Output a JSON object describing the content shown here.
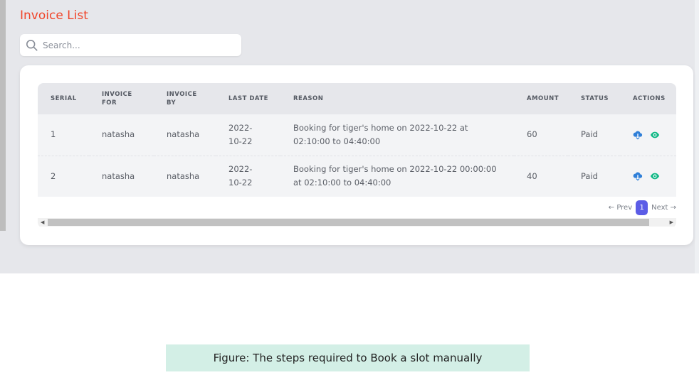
{
  "page": {
    "title": "Invoice List"
  },
  "search": {
    "placeholder": "Search..."
  },
  "table": {
    "columns": [
      "SERIAL",
      "INVOICE FOR",
      "INVOICE BY",
      "LAST DATE",
      "REASON",
      "AMOUNT",
      "STATUS",
      "ACTIONS"
    ],
    "rows": [
      {
        "serial": "1",
        "invoice_for": "natasha",
        "invoice_by": "natasha",
        "last_date": "2022-10-22",
        "reason": "Booking for tiger's home on 2022-10-22 at 02:10:00 to 04:40:00",
        "amount": "60",
        "status": "Paid"
      },
      {
        "serial": "2",
        "invoice_for": "natasha",
        "invoice_by": "natasha",
        "last_date": "2022-10-22",
        "reason": "Booking for tiger's home on 2022-10-22 00:00:00 at 02:10:00 to 04:40:00",
        "amount": "40",
        "status": "Paid"
      }
    ],
    "actions": [
      {
        "icon": "download-cloud-icon",
        "color": "#2f7fd8"
      },
      {
        "icon": "eye-icon",
        "color": "#12b886"
      }
    ]
  },
  "pagination": {
    "prev": "Prev",
    "current": "1",
    "next": "Next"
  },
  "caption": "Figure: The steps required to Book a slot manually",
  "colors": {
    "title": "#f0452a",
    "accent": "#5b5ce6"
  }
}
